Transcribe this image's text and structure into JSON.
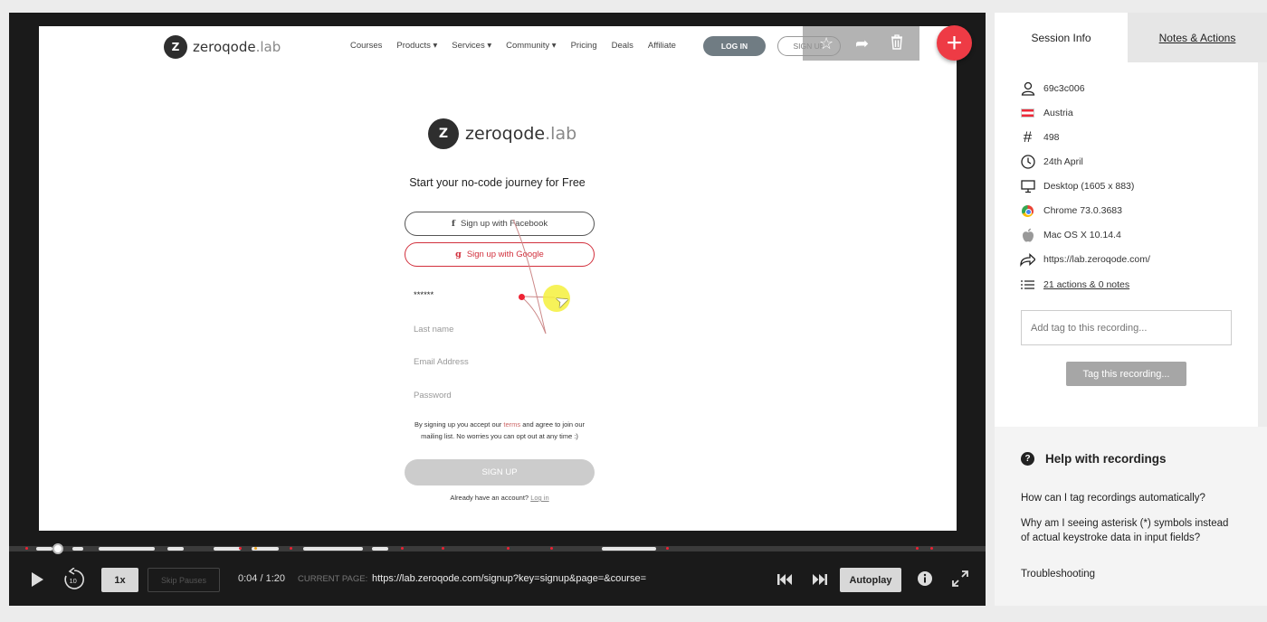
{
  "site": {
    "logo_text": "zeroqode",
    "logo_suffix": ".lab",
    "logo_mark": "Z",
    "nav_links": [
      "Courses",
      "Products ▾",
      "Services ▾",
      "Community ▾",
      "Pricing",
      "Deals",
      "Affiliate"
    ],
    "login_label": "LOG IN",
    "signup_label": "SIGN UP"
  },
  "signup_form": {
    "title": "Start your no-code journey for Free",
    "facebook_label": "Sign up with Facebook",
    "google_label": "Sign up with Google",
    "first_name_value": "******",
    "last_name_placeholder": "Last name",
    "email_placeholder": "Email Address",
    "password_placeholder": "Password",
    "terms_line1_prefix": "By signing up you accept our ",
    "terms_link": "terms",
    "terms_line1_suffix": " and agree to join our",
    "terms_line2": "mailing list. No worries you can opt out at any time :)",
    "submit_label": "SIGN UP",
    "already_text": "Already have an account? ",
    "login_link": "Log in"
  },
  "player": {
    "speed": "1x",
    "skip_label": "Skip Pauses",
    "time": "0:04 / 1:20",
    "current_page_label": "CURRENT PAGE:",
    "current_page_url": "https://lab.zeroqode.com/signup?key=signup&page=&course=",
    "autoplay_label": "Autoplay",
    "progress": 0.05
  },
  "panel": {
    "tabs": [
      "Session Info",
      "Notes & Actions"
    ],
    "session": {
      "user_id": "69c3c006",
      "country": "Austria",
      "number": "498",
      "date": "24th April",
      "device": "Desktop (1605 x 883)",
      "browser": "Chrome 73.0.3683",
      "os": "Mac OS X 10.14.4",
      "referrer": "https://lab.zeroqode.com/",
      "actions": "21 actions & 0 notes"
    },
    "tag_placeholder": "Add tag to this recording...",
    "tag_button": "Tag this recording...",
    "help_title": "Help with recordings",
    "help_links": [
      "How can I tag recordings automatically?",
      "Why am I seeing asterisk (*) symbols instead of actual keystroke data in input fields?",
      "Troubleshooting"
    ]
  },
  "colors": {
    "accent_red": "#ee3b45",
    "google_red": "#d2303d",
    "dark": "#1a1a1a"
  }
}
